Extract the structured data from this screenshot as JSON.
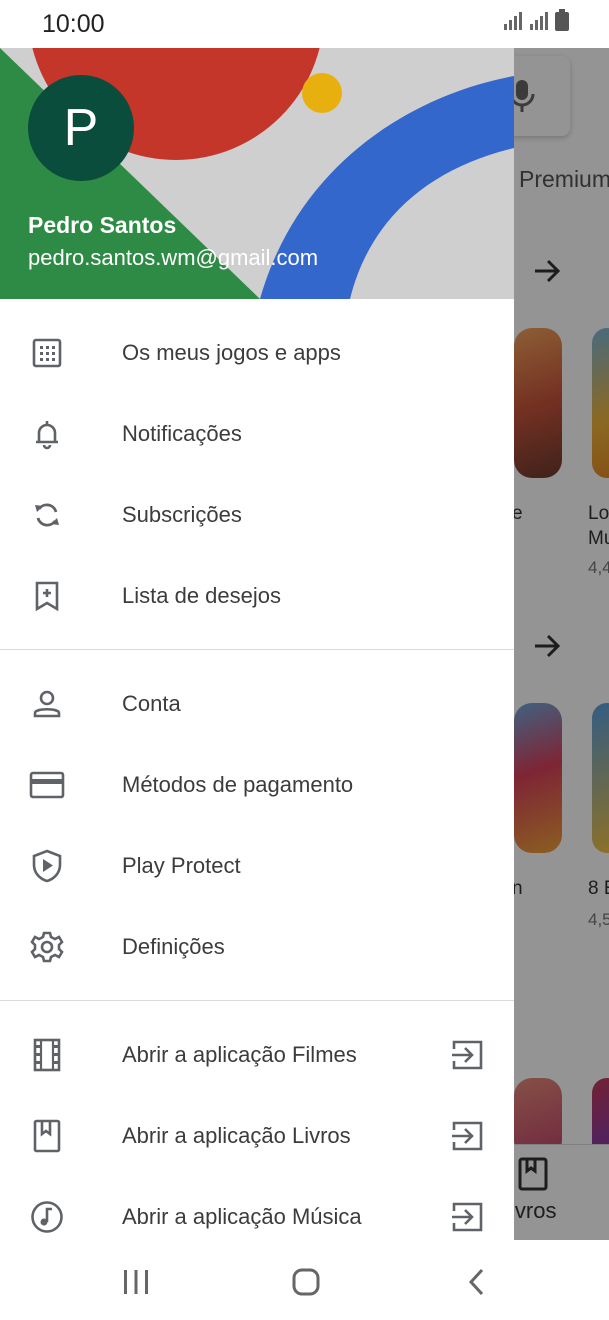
{
  "status_bar": {
    "time": "10:00",
    "icons": [
      "signal-icon",
      "signal-icon",
      "battery-icon"
    ]
  },
  "drawer": {
    "account": {
      "avatar_letter": "P",
      "name": "Pedro Santos",
      "email": "pedro.santos.wm@gmail.com"
    },
    "groups": [
      [
        {
          "label": "Os meus jogos e apps",
          "icon": "grid-icon"
        },
        {
          "label": "Notificações",
          "icon": "bell-icon"
        },
        {
          "label": "Subscrições",
          "icon": "refresh-icon"
        },
        {
          "label": "Lista de desejos",
          "icon": "bookmark-add-icon"
        }
      ],
      [
        {
          "label": "Conta",
          "icon": "person-icon"
        },
        {
          "label": "Métodos de pagamento",
          "icon": "credit-card-icon"
        },
        {
          "label": "Play Protect",
          "icon": "shield-play-icon"
        },
        {
          "label": "Definições",
          "icon": "gear-icon"
        }
      ],
      [
        {
          "label": "Abrir a aplicação Filmes",
          "icon": "film-icon",
          "trailing_icon": "open-app-icon"
        },
        {
          "label": "Abrir a aplicação Livros",
          "icon": "book-icon",
          "trailing_icon": "open-app-icon"
        },
        {
          "label": "Abrir a aplicação Música",
          "icon": "music-icon",
          "trailing_icon": "open-app-icon"
        }
      ]
    ]
  },
  "background": {
    "tab_partial": "Premium",
    "card_labels": [
      "e",
      "Lo",
      "Mu",
      "4,4",
      "n",
      "8 E",
      "4,5"
    ],
    "bottom_tab_partial": "ivros"
  },
  "nav_bar": {
    "buttons": [
      "recent-apps-icon",
      "home-icon",
      "back-icon"
    ]
  },
  "colors": {
    "accent_green": "#2e8b45",
    "accent_red": "#c4352a",
    "accent_blue": "#3367cc",
    "accent_yellow": "#e8b00e",
    "avatar_bg": "#0a4d3c",
    "icon_gray": "#5f6368",
    "text_gray": "#3c3c3c"
  }
}
